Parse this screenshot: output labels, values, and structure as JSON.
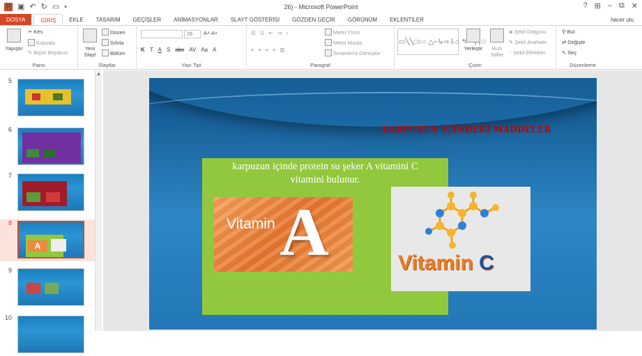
{
  "window": {
    "title": "26) - Microsoft PowerPoint",
    "help": "?",
    "controls": [
      "⊞",
      "–",
      "⧉",
      "✕"
    ],
    "user": "hacer ulu"
  },
  "ribbon_tabs": [
    "DOSYA",
    "GİRİŞ",
    "EKLE",
    "TASARIM",
    "GEÇİŞLER",
    "ANİMASYONLAR",
    "SLAYT GÖSTERİSİ",
    "GÖZDEN GEÇİR",
    "GÖRÜNÜM",
    "EKLENTİLER"
  ],
  "ribbon": {
    "pano": {
      "label": "Pano",
      "paste": "Yapıştır",
      "cut": "Kes",
      "copy": "Kopyala",
      "format_painter": "Biçim Boyacısı"
    },
    "slaytlar": {
      "label": "Slaytlar",
      "new_slide": "Yeni Slayt",
      "layout": "Düzen",
      "reset": "Sıfırla",
      "section": "Bölüm"
    },
    "yazi_tipi": {
      "label": "Yazı Tipi",
      "font_size": "26",
      "bold": "K",
      "italic": "T",
      "underline": "A",
      "shadow": "S",
      "strike": "abc",
      "spacing": "AV",
      "case": "Aa",
      "color": "A"
    },
    "paragraf": {
      "label": "Paragraf",
      "text_direction": "Metin Yönü",
      "align_text": "Metni Hizala",
      "smartart": "SmartArt'a Dönüştür"
    },
    "cizim": {
      "label": "Çizim",
      "arrange": "Yerleştir",
      "quick_styles": "Hızlı Stiller",
      "fill": "Şekil Dolgusu",
      "outline": "Şekil Anahattı",
      "effects": "Şekil Efektleri"
    },
    "duzenleme": {
      "label": "Düzenleme",
      "find": "Bul",
      "replace": "Değiştir",
      "select": "Seç"
    }
  },
  "thumbnails": [
    {
      "num": "5"
    },
    {
      "num": "6"
    },
    {
      "num": "7"
    },
    {
      "num": "8"
    },
    {
      "num": "9"
    },
    {
      "num": "10"
    }
  ],
  "slide": {
    "title": "KARPUZUN İÇİNDEKİ MADDELER",
    "body_line1": "karpuzun içinde protein su şeker A vitamini C",
    "body_line2": "vitamini bulunur.",
    "vitA_word": "Vitamin",
    "vitA_letter": "A",
    "vitC_word": "Vitamin ",
    "vitC_letter": "C"
  }
}
